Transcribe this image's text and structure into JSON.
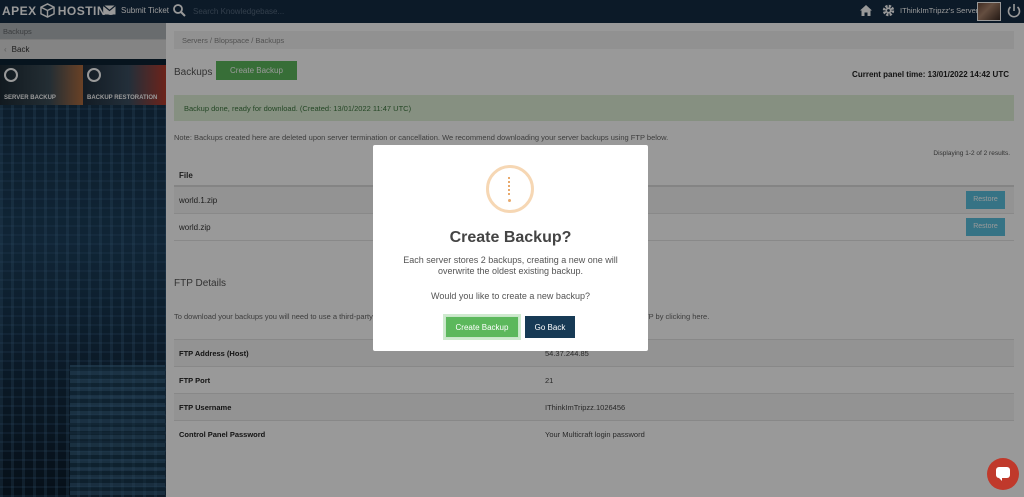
{
  "header": {
    "logo_left": "APEX",
    "logo_right": "HOSTING",
    "submit_ticket": "Submit Ticket",
    "search_placeholder": "Search Knowledgebase...",
    "user_servers": "IThinkImTripzz's Servers"
  },
  "sidebar": {
    "header": "Backups",
    "back_label": "Back",
    "promos": [
      {
        "label": "SERVER BACKUP"
      },
      {
        "label": "BACKUP RESTORATION"
      }
    ]
  },
  "main": {
    "breadcrumb": "Servers / Blopspace / Backups",
    "title": "Backups",
    "create_button": "Create Backup",
    "panel_time": "Current panel time: 13/01/2022 14:42 UTC",
    "alert": "Backup done, ready for download. (Created: 13/01/2022 11:47 UTC)",
    "note": "Note: Backups created here are deleted upon server termination or cancellation. We recommend downloading your server backups using FTP below.",
    "displaying": "Displaying 1-2 of 2 results.",
    "file_header": "File",
    "files": [
      {
        "name": "world.1.zip",
        "action": "Restore"
      },
      {
        "name": "world.zip",
        "action": "Restore"
      }
    ],
    "ftp_title": "FTP Details",
    "ftp_desc": "To download your backups you will need to use a third-party",
    "ftp_desc_tail": "TP by clicking here.",
    "ftp_rows": [
      {
        "key": "FTP Address (Host)",
        "value": "54.37.244.85"
      },
      {
        "key": "FTP Port",
        "value": "21"
      },
      {
        "key": "FTP Username",
        "value": "IThinkImTripzz.1026456"
      },
      {
        "key": "Control Panel Password",
        "value": "Your Multicraft login password"
      }
    ]
  },
  "modal": {
    "title": "Create Backup?",
    "text": "Each server stores 2 backups, creating a new one will overwrite the oldest existing backup.",
    "question": "Would you like to create a new backup?",
    "confirm": "Create Backup",
    "cancel": "Go Back"
  },
  "colors": {
    "topbar": "#152c44",
    "success": "#5cb85c",
    "info": "#5bc0de",
    "dark_button": "#173a55"
  }
}
